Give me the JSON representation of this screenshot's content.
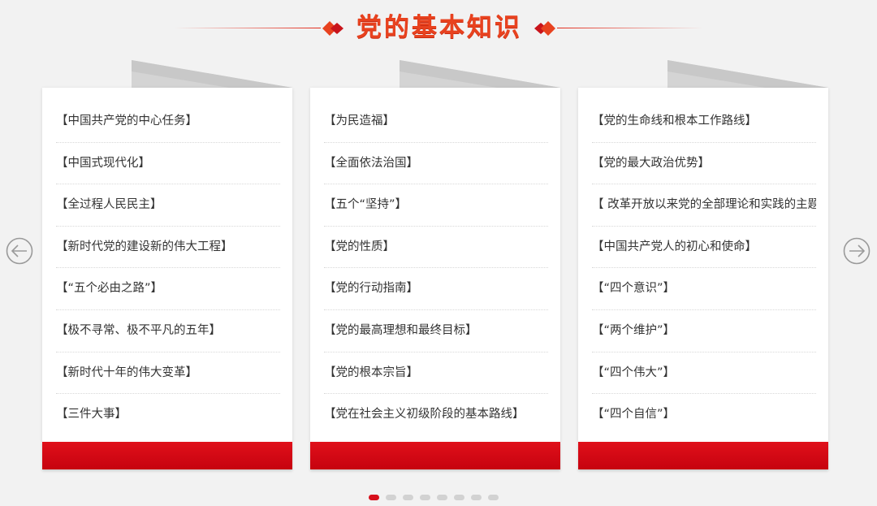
{
  "header": {
    "title": "党的基本知识"
  },
  "colors": {
    "accent": "#d7101c",
    "title": "#e8421f",
    "text": "#333333"
  },
  "icons": {
    "prev": "arrow-left-circle-icon",
    "next": "arrow-right-circle-icon"
  },
  "cards": [
    {
      "items": [
        "【中国共产党的中心任务】",
        "【中国式现代化】",
        "【全过程人民民主】",
        "【新时代党的建设新的伟大工程】",
        "【“五个必由之路”】",
        "【极不寻常、极不平凡的五年】",
        "【新时代十年的伟大变革】",
        "【三件大事】"
      ]
    },
    {
      "items": [
        "【为民造福】",
        "【全面依法治国】",
        "【五个“坚持”】",
        "【党的性质】",
        "【党的行动指南】",
        "【党的最高理想和最终目标】",
        "【党的根本宗旨】",
        "【党在社会主义初级阶段的基本路线】"
      ]
    },
    {
      "items": [
        "【党的生命线和根本工作路线】",
        "【党的最大政治优势】",
        "【 改革开放以来党的全部理论和实践的主题】",
        "【中国共产党人的初心和使命】",
        "【“四个意识”】",
        "【“两个维护”】",
        "【“四个伟大”】",
        "【“四个自信”】"
      ]
    }
  ],
  "pagination": {
    "count": 8,
    "active_index": 0
  }
}
